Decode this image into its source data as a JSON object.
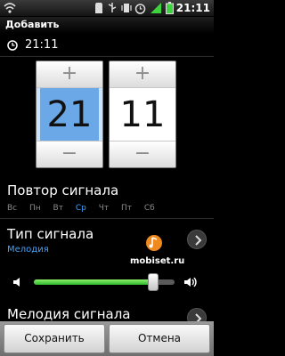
{
  "status_bar": {
    "time": "21:11",
    "icons": [
      "wifi-icon",
      "sd-card-icon",
      "usb-icon",
      "vibrate-icon",
      "alarm-icon",
      "signal-icon",
      "battery-icon"
    ]
  },
  "dialog": {
    "title": "Добавить"
  },
  "alarm_time": "21:11",
  "picker": {
    "hours": "21",
    "minutes": "11",
    "plus_label": "+",
    "minus_label": "−"
  },
  "repeat": {
    "label": "Повтор сигнала",
    "days": [
      {
        "label": "Вс",
        "selected": false
      },
      {
        "label": "Пн",
        "selected": false
      },
      {
        "label": "Вт",
        "selected": false
      },
      {
        "label": "Ср",
        "selected": true
      },
      {
        "label": "Чт",
        "selected": false
      },
      {
        "label": "Пт",
        "selected": false
      },
      {
        "label": "Сб",
        "selected": false
      }
    ]
  },
  "alarm_type": {
    "label": "Тип сигнала",
    "value": "Мелодия"
  },
  "watermark": "mobiset.ru",
  "volume": {
    "level": 0.85
  },
  "melody": {
    "label": "Мелодия сигнала"
  },
  "buttons": {
    "save": "Сохранить",
    "cancel": "Отмена"
  },
  "colors": {
    "accent": "#3fa3ff",
    "selected_picker": "#6aa8e8",
    "volume_fill": "#4fd64a",
    "note_icon": "#f08a1e"
  }
}
